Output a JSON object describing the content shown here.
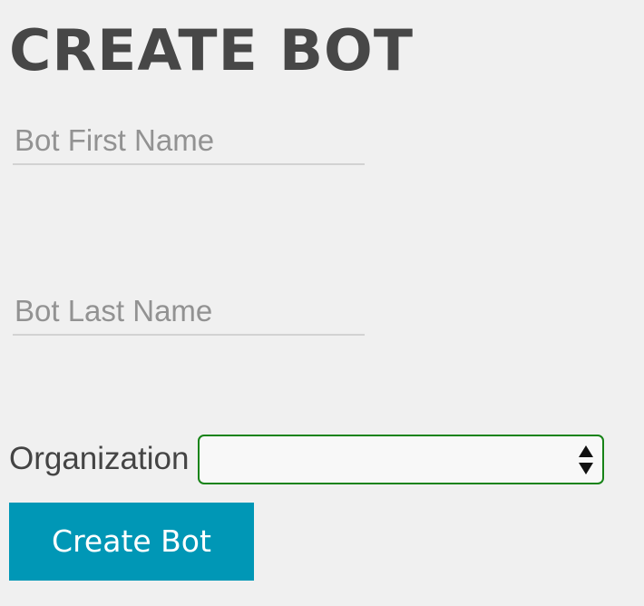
{
  "page": {
    "title": "CREATE BOT"
  },
  "form": {
    "first_name": {
      "placeholder": "Bot First Name",
      "value": ""
    },
    "last_name": {
      "placeholder": "Bot Last Name",
      "value": ""
    },
    "organization": {
      "label": "Organization",
      "selected": "",
      "border_color": "#178317"
    },
    "submit_label": "Create Bot",
    "submit_color": "#0097b6"
  }
}
